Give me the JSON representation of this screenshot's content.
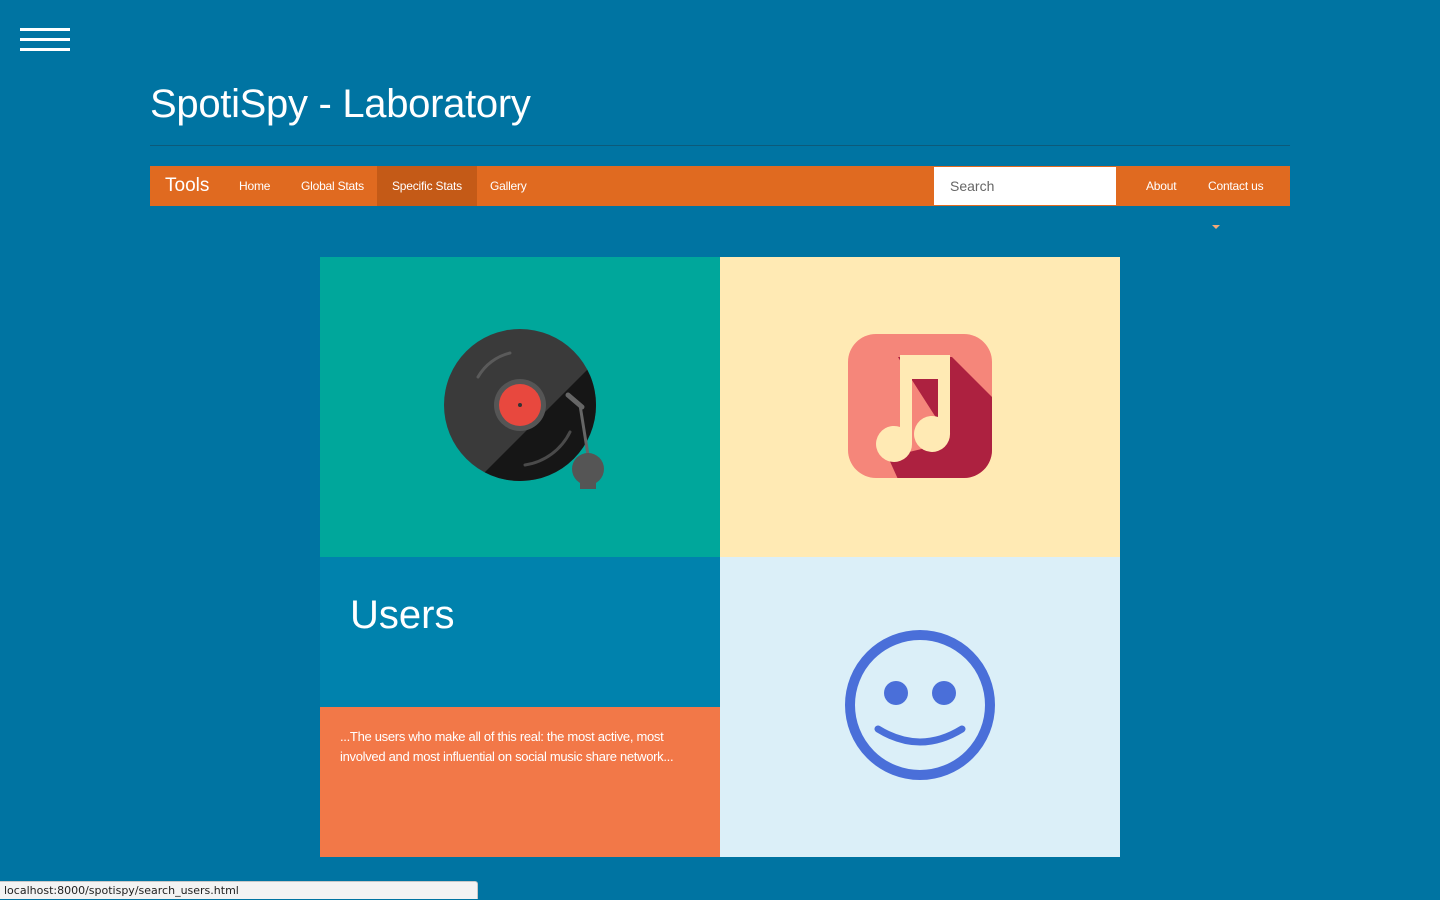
{
  "site": {
    "title": "SpotiSpy - Laboratory"
  },
  "navbar": {
    "brand": "Tools",
    "items": [
      {
        "label": "Home"
      },
      {
        "label": "Global Stats"
      },
      {
        "label": "Specific Stats",
        "active": true
      },
      {
        "label": "Gallery"
      }
    ],
    "search": {
      "placeholder": "Search",
      "value": ""
    },
    "right_items": [
      {
        "label": "About"
      },
      {
        "label": "Contact us",
        "dropdown": true
      }
    ]
  },
  "tiles": {
    "vinyl": {
      "icon": "vinyl-record-icon"
    },
    "music": {
      "icon": "music-note-icon"
    },
    "users": {
      "heading": "Users"
    },
    "description": {
      "text": "...The users who make all of this real: the most active, most involved and most influential on social music share network..."
    },
    "smile": {
      "icon": "smiley-face-icon"
    }
  },
  "status_bar": {
    "url": "localhost:8000/spotispy/search_users.html"
  },
  "colors": {
    "background": "#0074a2",
    "navbar": "#e06a20",
    "navbar_active": "#c45a17",
    "tile_teal": "#00a79b",
    "tile_cream": "#ffeab4",
    "tile_blue": "#0082ad",
    "tile_orange": "#f27848",
    "tile_lightblue": "#dbeff8",
    "smiley": "#4a6fd9"
  }
}
